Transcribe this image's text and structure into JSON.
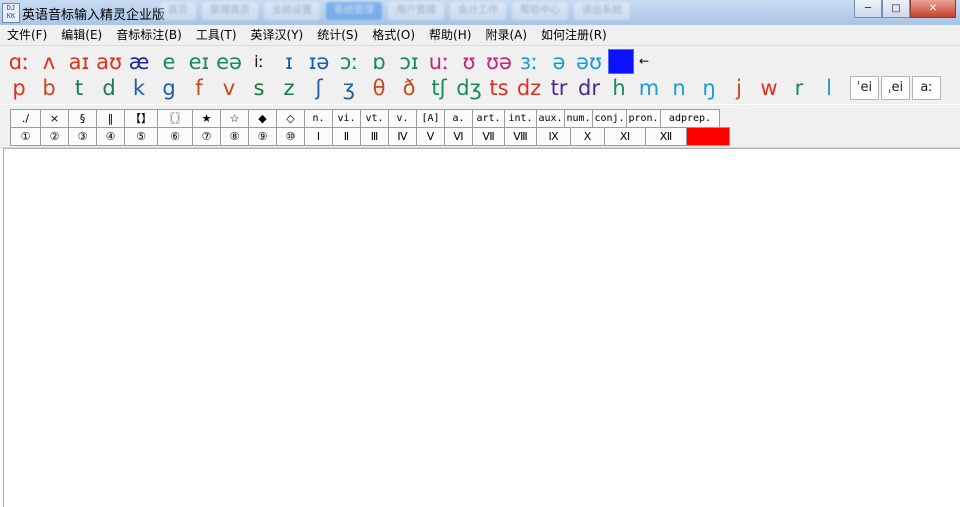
{
  "window": {
    "title": "英语音标输入精灵企业版",
    "app_icon_text": "DJ KK",
    "blurred_tabs": [
      "首页",
      "管理首页",
      "全局设置",
      "系统管理",
      "用户管理",
      "会计工作",
      "帮助中心",
      "退出系统"
    ],
    "min_glyph": "─",
    "max_glyph": "□",
    "close_glyph": "✕"
  },
  "menu": [
    "文件(F)",
    "编辑(E)",
    "音标标注(B)",
    "工具(T)",
    "英译汉(Y)",
    "统计(S)",
    "格式(O)",
    "帮助(H)",
    "附录(A)",
    "如何注册(R)"
  ],
  "phonetic_row1": [
    {
      "s": "ɑː",
      "c": "#e0301e"
    },
    {
      "s": "ʌ",
      "c": "#e0301e"
    },
    {
      "s": "aɪ",
      "c": "#e0301e"
    },
    {
      "s": "aʊ",
      "c": "#e0301e"
    },
    {
      "s": "æ",
      "c": "#1f2a8c"
    },
    {
      "s": "e",
      "c": "#1a8a5a"
    },
    {
      "s": "eɪ",
      "c": "#1a8a5a"
    },
    {
      "s": "eə",
      "c": "#1a8a5a"
    },
    {
      "s": "iː",
      "c": "#111111",
      "small": true
    },
    {
      "s": "ɪ",
      "c": "#1f5fa8"
    },
    {
      "s": "ɪə",
      "c": "#1f5fa8"
    },
    {
      "s": "ɔː",
      "c": "#1a8a5a"
    },
    {
      "s": "ɒ",
      "c": "#1a8a5a"
    },
    {
      "s": "ɔɪ",
      "c": "#1a8a5a"
    },
    {
      "s": "uː",
      "c": "#c0267a"
    },
    {
      "s": "ʊ",
      "c": "#c0267a"
    },
    {
      "s": "ʊə",
      "c": "#c0267a"
    },
    {
      "s": "ɜː",
      "c": "#1e9ad6"
    },
    {
      "s": "ə",
      "c": "#1e9ad6"
    },
    {
      "s": "əʊ",
      "c": "#1e9ad6"
    }
  ],
  "phonetic_row2": [
    {
      "s": "p",
      "c": "#e0301e"
    },
    {
      "s": "b",
      "c": "#c84a1e"
    },
    {
      "s": "t",
      "c": "#1a7a4a"
    },
    {
      "s": "d",
      "c": "#1a7a4a"
    },
    {
      "s": "k",
      "c": "#1f5fa8"
    },
    {
      "s": "g",
      "c": "#1f5fa8"
    },
    {
      "s": "f",
      "c": "#c84a1e"
    },
    {
      "s": "v",
      "c": "#c84a1e"
    },
    {
      "s": "s",
      "c": "#1a7a4a"
    },
    {
      "s": "z",
      "c": "#1a7a4a"
    },
    {
      "s": "ʃ",
      "c": "#1f5fa8"
    },
    {
      "s": "ʒ",
      "c": "#1f5fa8"
    },
    {
      "s": "θ",
      "c": "#c84a1e"
    },
    {
      "s": "ð",
      "c": "#c84a1e"
    },
    {
      "s": "tʃ",
      "c": "#1a8a5a"
    },
    {
      "s": "dʒ",
      "c": "#1a8a5a"
    },
    {
      "s": "ts",
      "c": "#e0301e"
    },
    {
      "s": "dz",
      "c": "#e0301e"
    },
    {
      "s": "tr",
      "c": "#4a2a8a"
    },
    {
      "s": "dr",
      "c": "#4a2a8a"
    },
    {
      "s": "h",
      "c": "#1a8a5a"
    },
    {
      "s": "m",
      "c": "#1e9ad6"
    },
    {
      "s": "n",
      "c": "#1e9ad6"
    },
    {
      "s": "ŋ",
      "c": "#1e9ad6"
    },
    {
      "s": "j",
      "c": "#c84a1e"
    },
    {
      "s": "w",
      "c": "#e0301e"
    },
    {
      "s": "r",
      "c": "#1a8a5a"
    },
    {
      "s": "l",
      "c": "#1e9ad6"
    }
  ],
  "phonetic_buttons": [
    "ˈei",
    "ˌei",
    "aː"
  ],
  "arrow_glyph": "←",
  "colors": {
    "blue_square": "#0a12ff",
    "red_cell": "#ff0000"
  },
  "symbols_top": [
    "./",
    "×",
    "§",
    "‖",
    "【】",
    "〖〗",
    "★",
    "☆",
    "◆",
    "◇",
    "n.",
    "vi.",
    "vt.",
    "v.",
    "[A]",
    "a.",
    "art.",
    "int.",
    "aux.",
    "num.",
    "conj.",
    "pron.",
    "adprep."
  ],
  "symbols_bottom": [
    "①",
    "②",
    "③",
    "④",
    "⑤",
    "⑥",
    "⑦",
    "⑧",
    "⑨",
    "⑩",
    "Ⅰ",
    "Ⅱ",
    "Ⅲ",
    "Ⅳ",
    "Ⅴ",
    "Ⅵ",
    "Ⅶ",
    "Ⅷ",
    "Ⅸ",
    "Ⅹ",
    "Ⅺ",
    "Ⅻ"
  ]
}
